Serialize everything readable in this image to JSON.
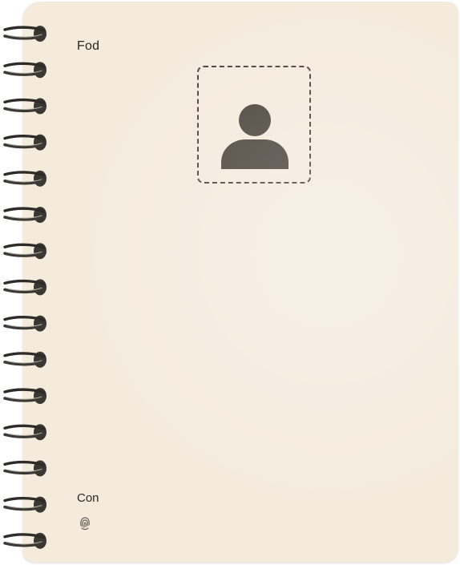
{
  "notebook": {
    "title": "Fod",
    "footer_label": "Con"
  },
  "icons": {
    "avatar": "user-silhouette-icon",
    "footer": "fingerprint-icon"
  },
  "colors": {
    "paper": "#f4ebdd",
    "avatar": "#4e473f",
    "frame_border": "#4a443d",
    "ring": "#3a3632"
  }
}
